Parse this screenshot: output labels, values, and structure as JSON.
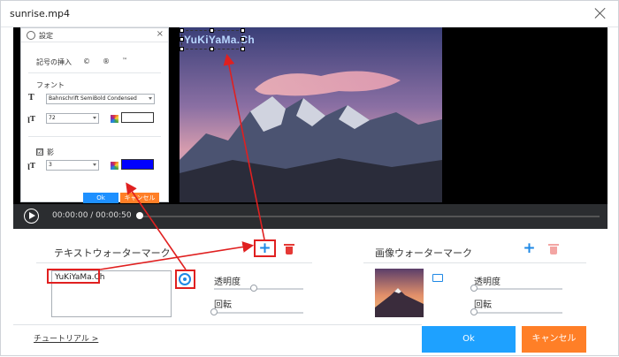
{
  "window": {
    "title": "sunrise.mp4"
  },
  "preview": {
    "watermark_text": "YuKiYaMa.Ch"
  },
  "player": {
    "time": "00:00:00 / 00:00:50"
  },
  "settings_dialog": {
    "title": "設定",
    "symbol_label": "記号の挿入",
    "symbols": [
      "©",
      "®",
      "™"
    ],
    "font_label": "フォント",
    "font_value": "Bahnschrift SemiBold Condensed",
    "size_value": "72",
    "text_color": "#ffffff",
    "shadow_label": "影",
    "shadow_checked": "☑",
    "shadow_size": "3",
    "shadow_color": "#0000ff",
    "ok": "Ok",
    "cancel": "キャンセル"
  },
  "text_watermark": {
    "title": "テキストウォーターマーク",
    "input_value": "YuKiYaMa.Ch",
    "opacity_label": "透明度",
    "rotation_label": "回転",
    "opacity_pct": 45,
    "rotation_pct": 0
  },
  "image_watermark": {
    "title": "画像ウォーターマーク",
    "opacity_label": "透明度",
    "rotation_label": "回転",
    "opacity_pct": 0,
    "rotation_pct": 0
  },
  "footer": {
    "tutorial": "チュートリアル >",
    "ok": "Ok",
    "cancel": "キャンセル"
  },
  "colors": {
    "accent_blue": "#1ea1ff",
    "accent_orange": "#ff7f27",
    "delete_red": "#e53935",
    "highlight_red": "#e02020"
  }
}
